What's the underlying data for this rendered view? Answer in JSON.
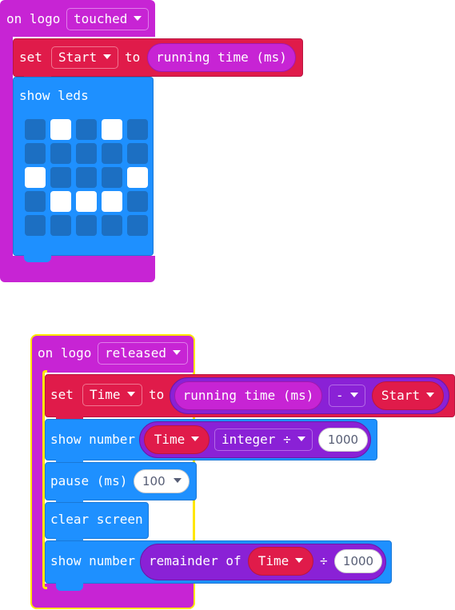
{
  "colors": {
    "event": "#c724d4",
    "variable": "#e01b4a",
    "basic": "#1e90ff",
    "math": "#8a21d6",
    "selected_outline": "#ffe600"
  },
  "block1": {
    "event_text": "on logo",
    "event_dropdown": "touched",
    "set_text": "set",
    "set_var": "Start",
    "set_to": "to",
    "running_time": "running time (ms)",
    "show_leds_label": "show leds",
    "leds": [
      [
        0,
        1,
        0,
        1,
        0
      ],
      [
        0,
        0,
        0,
        0,
        0
      ],
      [
        1,
        0,
        0,
        0,
        1
      ],
      [
        0,
        1,
        1,
        1,
        0
      ],
      [
        0,
        0,
        0,
        0,
        0
      ]
    ]
  },
  "block2": {
    "event_text": "on logo",
    "event_dropdown": "released",
    "set_text": "set",
    "set_var": "Time",
    "set_to": "to",
    "running_time": "running time (ms)",
    "minus_op": "-",
    "start_var": "Start",
    "show_number_1": "show number",
    "time_var_1": "Time",
    "integer_div": "integer ÷",
    "divisor_1": "1000",
    "pause_label": "pause (ms)",
    "pause_value": "100",
    "clear_screen": "clear screen",
    "show_number_2": "show number",
    "remainder_of": "remainder of",
    "time_var_2": "Time",
    "div_symbol": "÷",
    "divisor_2": "1000"
  }
}
